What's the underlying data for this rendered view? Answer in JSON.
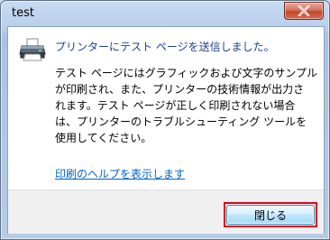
{
  "window": {
    "title": "test"
  },
  "icons": {
    "title_close": "close-icon",
    "printer": "printer-icon"
  },
  "message": {
    "heading": "プリンターにテスト ページを送信しました。",
    "body_lines": [
      "テスト ページにはグラフィックおよび文字のサンプル",
      "が印刷され、また、プリンターの技術情報が出力さ",
      "れます。テスト ページが正しく印刷されない場合",
      "は、プリンターのトラブルシューティング ツールを",
      "使用してください。"
    ],
    "help_link": "印刷のヘルプを表示します"
  },
  "footer": {
    "close_label": "閉じる"
  },
  "colors": {
    "heading": "#1f3f8f",
    "link": "#0066cc",
    "highlight": "#e0001b"
  }
}
